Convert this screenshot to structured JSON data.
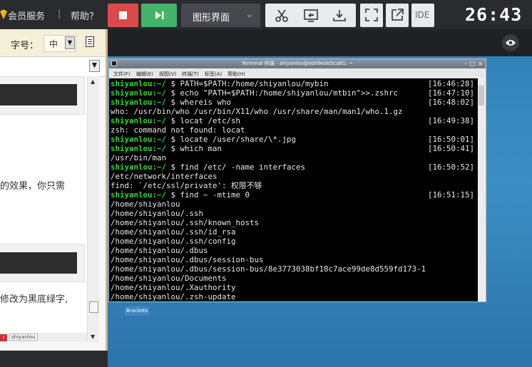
{
  "topbar": {
    "vip_link": "会员服务",
    "separator": "|",
    "help_link": "帮助？",
    "mode_select": "图形界面",
    "ide_label": "IDE",
    "timer": "26:43"
  },
  "left_panel": {
    "font_size_label": "字号：",
    "font_size_value": "中",
    "text_line_1": "的效果，你只需",
    "text_line_2": "修改为黑底绿字,",
    "taskbar_label": "shiyanlou"
  },
  "terminal": {
    "title": "Terminal 终端 - shiyanlou@eb09ede5ca81: ~",
    "menu": [
      "文件(F)",
      "编辑(E)",
      "视图(V)",
      "终端(T)",
      "标签(A)",
      "帮助(H)"
    ],
    "lines": [
      {
        "user": "shiyanlou:~/",
        "text": " $ PATH=$PATH:/home/shiyanlou/mybin",
        "time": "[16:46:28]"
      },
      {
        "user": "shiyanlou:~/",
        "text": " $ echo \"PATH=$PATH:/home/shiyanlou/mtbin\">>.zshrc",
        "time": "[16:47:10]"
      },
      {
        "user": "shiyanlou:~/",
        "text": " $ whereis who",
        "time": "[16:48:02]"
      },
      {
        "user": "",
        "text": "who: /usr/bin/who /usr/bin/X11/who /usr/share/man/man1/who.1.gz",
        "time": ""
      },
      {
        "user": "shiyanlou:~/",
        "text": " $ locat /etc/sh",
        "time": "[16:49:38]"
      },
      {
        "user": "",
        "text": "zsh: command not found: locat",
        "time": ""
      },
      {
        "user": "shiyanlou:~/",
        "text": " $ locate /user/share/\\*.jpg",
        "time": "[16:50:01]"
      },
      {
        "user": "shiyanlou:~/",
        "text": " $ which man",
        "time": "[16:50:41]"
      },
      {
        "user": "",
        "text": "/usr/bin/man",
        "time": ""
      },
      {
        "user": "shiyanlou:~/",
        "text": " $ find /etc/ -name interfaces",
        "time": "[16:50:52]"
      },
      {
        "user": "",
        "text": "/etc/network/interfaces",
        "time": ""
      },
      {
        "user": "",
        "text": "find: `/etc/ssl/private': 权限不够",
        "time": ""
      },
      {
        "user": "shiyanlou:~/",
        "text": " $ find ~ -mtime 0",
        "time": "[16:51:15]"
      },
      {
        "user": "",
        "text": "/home/shiyanlou",
        "time": ""
      },
      {
        "user": "",
        "text": "/home/shiyanlou/.ssh",
        "time": ""
      },
      {
        "user": "",
        "text": "/home/shiyanlou/.ssh/known_hosts",
        "time": ""
      },
      {
        "user": "",
        "text": "/home/shiyanlou/.ssh/id_rsa",
        "time": ""
      },
      {
        "user": "",
        "text": "/home/shiyanlou/.ssh/config",
        "time": ""
      },
      {
        "user": "",
        "text": "/home/shiyanlou/.dbus",
        "time": ""
      },
      {
        "user": "",
        "text": "/home/shiyanlou/.dbus/session-bus",
        "time": ""
      },
      {
        "user": "",
        "text": "/home/shiyanlou/.dbus/session-bus/8e3773038bf18c7ace99de8d559fd173-1",
        "time": ""
      },
      {
        "user": "",
        "text": "/home/shiyanlou/Documents",
        "time": ""
      },
      {
        "user": "",
        "text": "/home/shiyanlou/.Xauthority",
        "time": ""
      },
      {
        "user": "",
        "text": "/home/shiyanlou/.zsh-update",
        "time": ""
      }
    ]
  },
  "desktop": {
    "taskbar_item": "Brackets"
  }
}
